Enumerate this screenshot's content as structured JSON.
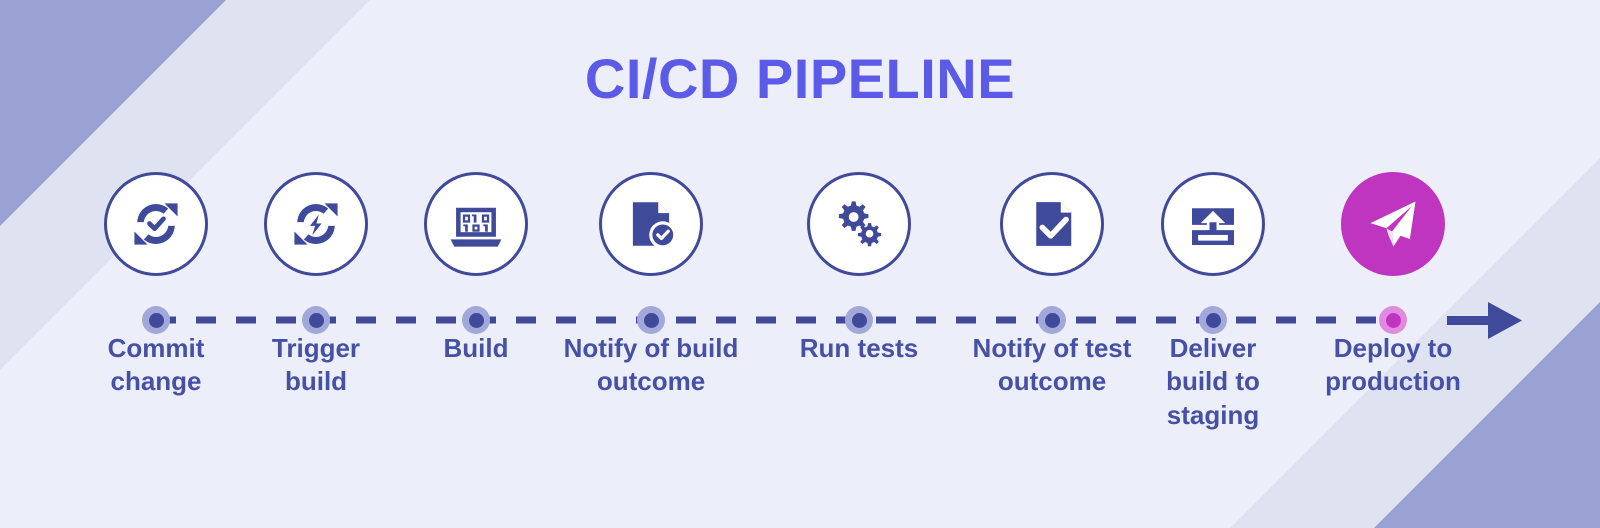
{
  "title": "CI/CD PIPELINE",
  "colors": {
    "background": "#ECEFF9",
    "band_light": "#DFE2F1",
    "band_dark": "#9AA1D3",
    "title": "#5B5BE8",
    "icon_navy": "#3F4A9B",
    "label": "#4650A5",
    "accent_magenta": "#BF35C0",
    "accent_magenta_ring": "#E08BE0",
    "node_ring": "#A2A9DA",
    "dash": "#3F4A9B"
  },
  "steps": [
    {
      "label": "Commit\nchange",
      "label_lines": [
        "Commit",
        "change"
      ],
      "icon": "sync-check-icon",
      "accent": false
    },
    {
      "label": "Trigger\nbuild",
      "label_lines": [
        "Trigger",
        "build"
      ],
      "icon": "sync-bolt-icon",
      "accent": false
    },
    {
      "label": "Build",
      "label_lines": [
        "Build"
      ],
      "icon": "laptop-binary-icon",
      "accent": false
    },
    {
      "label": "Notify of build\noutcome",
      "label_lines": [
        "Notify of build",
        "outcome"
      ],
      "icon": "document-check-badge-icon",
      "accent": false
    },
    {
      "label": "Run tests",
      "label_lines": [
        "Run tests"
      ],
      "icon": "gears-icon",
      "accent": false
    },
    {
      "label": "Notify of test\noutcome",
      "label_lines": [
        "Notify of test",
        "outcome"
      ],
      "icon": "document-check-icon",
      "accent": false
    },
    {
      "label": "Deliver\nbuild to\nstaging",
      "label_lines": [
        "Deliver",
        "build to",
        "staging"
      ],
      "icon": "upload-deliver-icon",
      "accent": false
    },
    {
      "label": "Deploy to\nproduction",
      "label_lines": [
        "Deploy to",
        "production"
      ],
      "icon": "paper-plane-icon",
      "accent": true
    }
  ],
  "timeline": {
    "style": "dashed",
    "end_marker": "arrow-right-icon",
    "node_count": 8
  }
}
